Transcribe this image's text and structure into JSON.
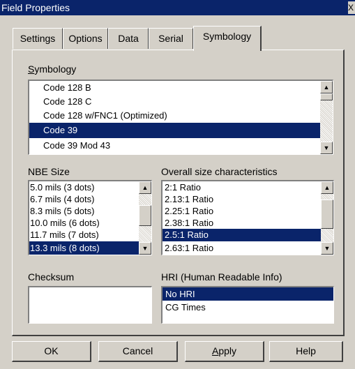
{
  "window": {
    "title": "Field Properties",
    "close_glyph": "X"
  },
  "tabs": [
    {
      "label": "Settings"
    },
    {
      "label": "Options"
    },
    {
      "label": "Data"
    },
    {
      "label": "Serial"
    },
    {
      "label": "Symbology",
      "active": true
    }
  ],
  "symbology": {
    "label_prefix": "S",
    "label_rest": "ymbology",
    "items": [
      "Code 128 B",
      "Code 128 C",
      "Code 128 w/FNC1 (Optimized)",
      "Code 39",
      "Code 39 Mod 43"
    ],
    "selected": "Code 39"
  },
  "nbe_size": {
    "label": "NBE Size",
    "items": [
      "5.0 mils (3 dots)",
      "6.7 mils (4 dots)",
      "8.3 mils (5 dots)",
      "10.0 mils (6 dots)",
      "11.7 mils (7 dots)",
      "13.3 mils (8 dots)"
    ],
    "selected": "13.3 mils (8 dots)"
  },
  "overall_size": {
    "label": "Overall size characteristics",
    "items": [
      "2:1 Ratio",
      "2.13:1 Ratio",
      "2.25:1 Ratio",
      "2.38:1 Ratio",
      "2.5:1 Ratio",
      "2.63:1 Ratio"
    ],
    "selected": "2.5:1 Ratio"
  },
  "checksum": {
    "label": "Checksum",
    "items": []
  },
  "hri": {
    "label": "HRI (Human Readable Info)",
    "items": [
      "No HRI",
      "CG Times"
    ],
    "selected": "No HRI"
  },
  "buttons": {
    "ok": "OK",
    "cancel": "Cancel",
    "apply_prefix": "A",
    "apply_rest": "pply",
    "help": "Help"
  },
  "icons": {
    "scroll_up": "▲",
    "scroll_down": "▼"
  },
  "colors": {
    "selection": "#0a246a",
    "face": "#d4d0c8"
  }
}
